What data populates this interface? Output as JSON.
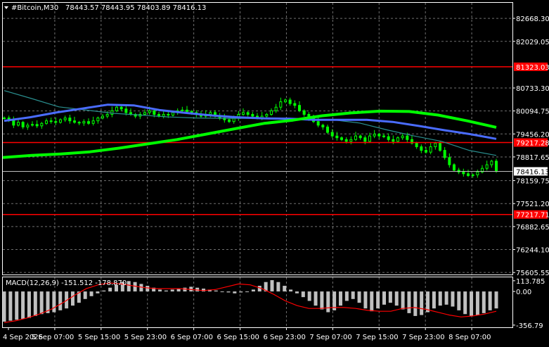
{
  "header": {
    "symbol": "#Bitcoin,M30",
    "ohlc": "78443.57 78443.95 78403.89 78416.13"
  },
  "macd": {
    "label": "MACD(12,26,9) -151.512 -178.870"
  },
  "colors": {
    "background": "#000000",
    "grid": "#6f6f6f",
    "candles": "#00ff00",
    "level_lines": "#ff0000",
    "ma_fast": "#2a8f8f",
    "ma_mid": "#4a6cff",
    "ma_slow": "#00ff00",
    "macd_hist": "#c0c0c0",
    "macd_signal": "#ff0000",
    "axis_text": "#ffffff",
    "price_tag_bg": "#ffffff",
    "price_tag_text": "#000000"
  },
  "chart_data": [
    {
      "type": "line",
      "name": "price",
      "y_ticks": [
        "82668.30",
        "82029.05",
        "80733.30",
        "80094.75",
        "79456.20",
        "78817.65",
        "78159.75",
        "77521.20",
        "76882.65",
        "76244.10",
        "75605.55"
      ],
      "x_ticks": [
        "4 Sep 2026",
        "5 Sep 07:00",
        "5 Sep 15:00",
        "5 Sep 23:00",
        "6 Sep 07:00",
        "6 Sep 15:00",
        "6 Sep 23:00",
        "7 Sep 07:00",
        "7 Sep 15:00",
        "7 Sep 23:00",
        "8 Sep 07:00"
      ],
      "ylim": [
        75550,
        83100
      ],
      "level_lines": [
        {
          "value": 81323.03,
          "label": "81323.03"
        },
        {
          "value": 79217.28,
          "label": "79217.28"
        },
        {
          "value": 77217.71,
          "label": "77217.71"
        }
      ],
      "current_price": {
        "value": 78416.13,
        "label": "78416.13"
      },
      "close": [
        79900,
        79850,
        79700,
        79780,
        79650,
        79700,
        79720,
        79680,
        79750,
        79820,
        79800,
        79780,
        79850,
        79900,
        79820,
        79780,
        79760,
        79800,
        79750,
        79820,
        79900,
        79950,
        80000,
        80100,
        80200,
        80150,
        80050,
        80000,
        79950,
        80000,
        80050,
        80100,
        80000,
        79950,
        80000,
        79980,
        80050,
        80100,
        80120,
        80080,
        80050,
        80000,
        79950,
        80000,
        80050,
        79950,
        79900,
        79850,
        79800,
        79900,
        80000,
        80050,
        80000,
        79950,
        79900,
        79950,
        80000,
        80100,
        80200,
        80350,
        80400,
        80300,
        80250,
        80100,
        80000,
        79900,
        79800,
        79700,
        79650,
        79500,
        79400,
        79350,
        79300,
        79250,
        79300,
        79400,
        79350,
        79250,
        79400,
        79450,
        79400,
        79380,
        79300,
        79250,
        79350,
        79400,
        79300,
        79200,
        79100,
        79000,
        78950,
        79100,
        79200,
        79000,
        78800,
        78600,
        78450,
        78400,
        78350,
        78300,
        78320,
        78400,
        78500,
        78600,
        78700,
        78416
      ],
      "series": [
        {
          "name": "ma_fast",
          "values": [
            80660,
            80440,
            80210,
            80120,
            80030,
            79980,
            79930,
            79900,
            79890,
            79890,
            79870,
            79860,
            79850,
            79760,
            79570,
            79400,
            79250,
            79000,
            78860
          ]
        },
        {
          "name": "ma_mid",
          "values": [
            79820,
            79920,
            80050,
            80160,
            80270,
            80250,
            80120,
            80040,
            79970,
            79920,
            79890,
            79880,
            79850,
            79850,
            79850,
            79790,
            79680,
            79560,
            79450,
            79320
          ]
        },
        {
          "name": "ma_slow",
          "values": [
            78800,
            78860,
            78900,
            78960,
            79060,
            79180,
            79300,
            79450,
            79600,
            79750,
            79840,
            79960,
            80040,
            80090,
            80080,
            79980,
            79820,
            79640
          ]
        }
      ]
    },
    {
      "type": "bar",
      "name": "MACD",
      "y_ticks": [
        "113.785",
        "0.00",
        "-356.79"
      ],
      "ylim": [
        -380,
        150
      ],
      "values": [
        -320,
        -310,
        -300,
        -290,
        -280,
        -260,
        -240,
        -230,
        -220,
        -200,
        -180,
        -150,
        -120,
        -80,
        -50,
        -20,
        10,
        40,
        70,
        100,
        110,
        100,
        80,
        60,
        40,
        20,
        10,
        20,
        30,
        40,
        50,
        40,
        30,
        20,
        10,
        0,
        -10,
        -20,
        -10,
        0,
        20,
        60,
        100,
        120,
        100,
        60,
        20,
        -20,
        -60,
        -100,
        -150,
        -190,
        -220,
        -200,
        -150,
        -100,
        -80,
        -120,
        -180,
        -210,
        -180,
        -140,
        -120,
        -150,
        -190,
        -230,
        -260,
        -250,
        -220,
        -180,
        -150,
        -140,
        -160,
        -200,
        -240,
        -260,
        -250,
        -230,
        -200,
        -180
      ],
      "series": [
        {
          "name": "signal",
          "values": [
            -330,
            -310,
            -280,
            -240,
            -190,
            -120,
            -40,
            30,
            70,
            90,
            80,
            60,
            40,
            30,
            30,
            30,
            20,
            10,
            20,
            50,
            80,
            70,
            30,
            -30,
            -100,
            -150,
            -180,
            -180,
            -170,
            -170,
            -180,
            -200,
            -210,
            -210,
            -180,
            -170,
            -190,
            -220,
            -250,
            -270,
            -260,
            -240,
            -210
          ]
        }
      ]
    }
  ]
}
